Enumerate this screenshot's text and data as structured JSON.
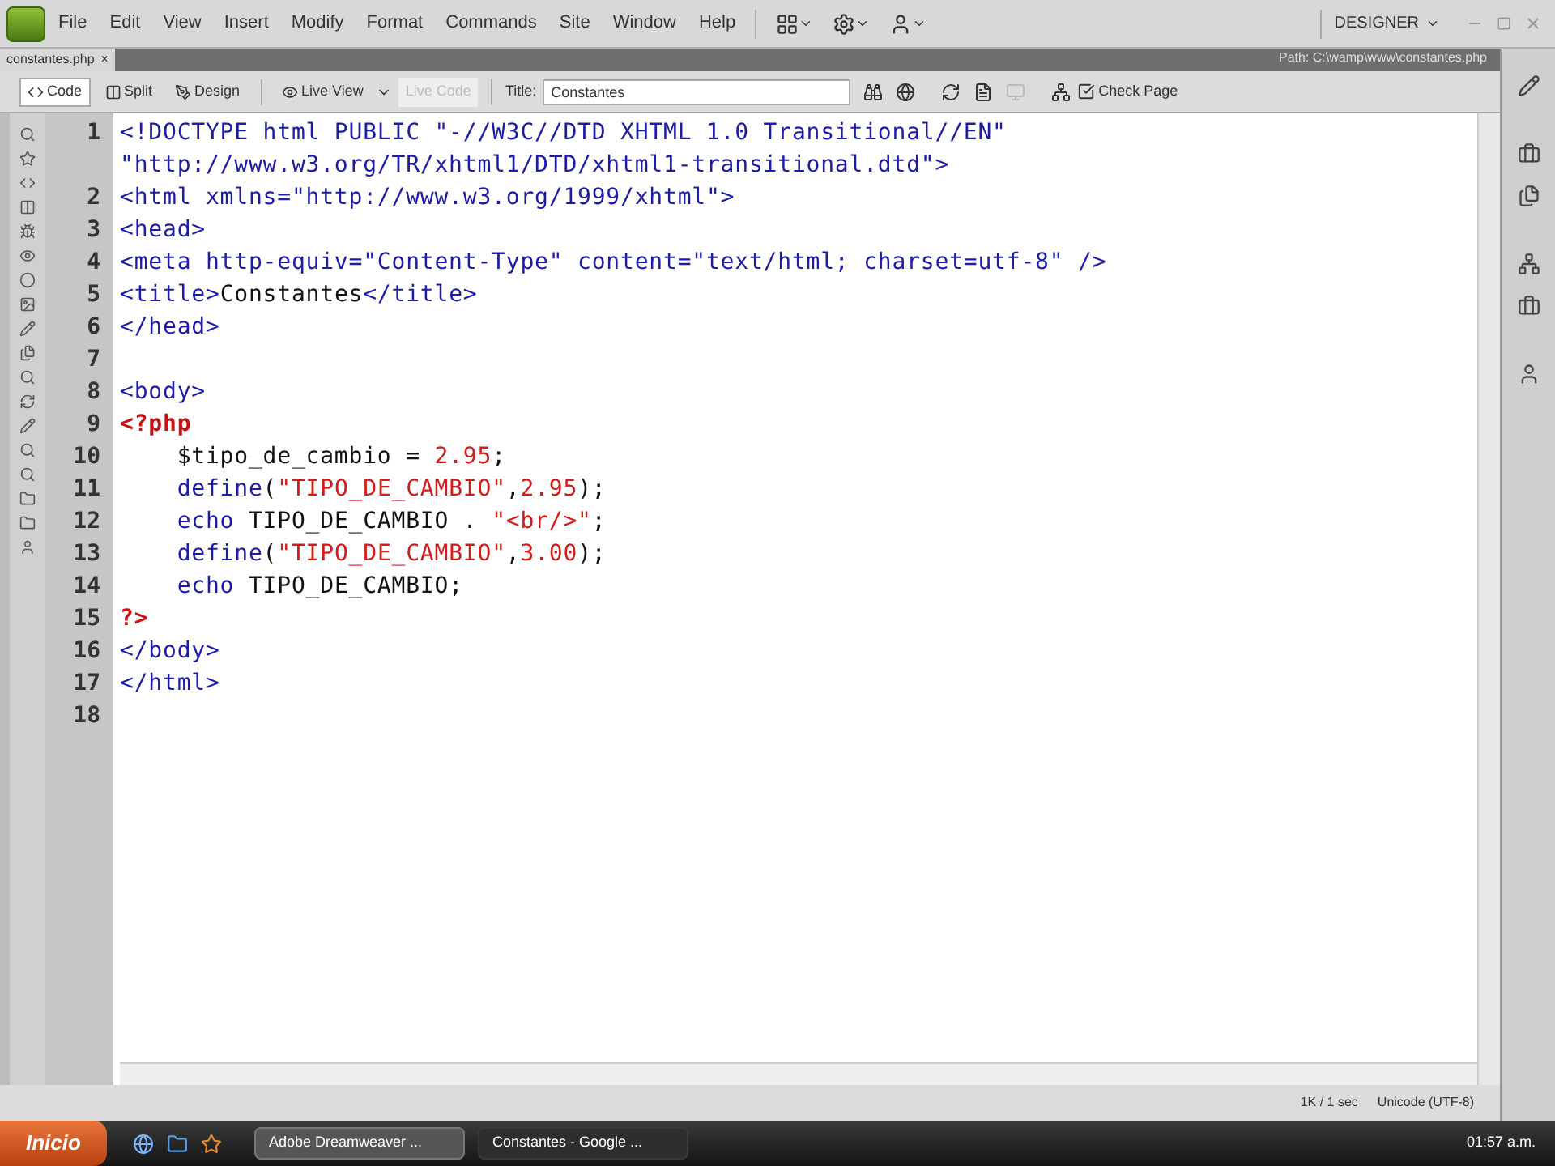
{
  "menu": [
    "File",
    "Edit",
    "View",
    "Insert",
    "Modify",
    "Format",
    "Commands",
    "Site",
    "Window",
    "Help"
  ],
  "workspace": "DESIGNER",
  "document_tab": {
    "label": "constantes.php",
    "close": "×"
  },
  "path": "Path: C:\\wamp\\www\\constantes.php",
  "view_buttons": [
    {
      "label": "Code",
      "selected": true
    },
    {
      "label": "Split",
      "selected": false
    },
    {
      "label": "Design",
      "selected": false
    }
  ],
  "live_view": {
    "label": "Live View"
  },
  "live_code": {
    "label": "Live Code",
    "disabled": true
  },
  "title_field": {
    "label": "Title:",
    "value": "Constantes"
  },
  "check_page": "Check Page",
  "code_lines": [
    {
      "number": "1",
      "rows": [
        [
          {
            "kind": "markup",
            "text": "<!DOCTYPE html PUBLIC \"-//W3C//DTD XHTML 1.0 Transitional//EN\""
          }
        ],
        [
          {
            "kind": "markup",
            "text": "\"http://www.w3.org/TR/xhtml1/DTD/xhtml1-transitional.dtd\">"
          }
        ]
      ]
    },
    {
      "number": "2",
      "rows": [
        [
          {
            "kind": "markup",
            "text": "<html xmlns=\"http://www.w3.org/1999/xhtml\">"
          }
        ]
      ]
    },
    {
      "number": "3",
      "rows": [
        [
          {
            "kind": "markup",
            "text": "<head>"
          }
        ]
      ]
    },
    {
      "number": "4",
      "rows": [
        [
          {
            "kind": "markup",
            "text": "<meta http-equiv=\"Content-Type\" content=\"text/html; charset=utf-8\" />"
          }
        ]
      ]
    },
    {
      "number": "5",
      "rows": [
        [
          {
            "kind": "markup",
            "text": "<title>"
          },
          {
            "kind": "plain",
            "text": "Constantes"
          },
          {
            "kind": "markup",
            "text": "</title>"
          }
        ]
      ]
    },
    {
      "number": "6",
      "rows": [
        [
          {
            "kind": "markup",
            "text": "</head>"
          }
        ]
      ]
    },
    {
      "number": "7",
      "rows": [
        []
      ]
    },
    {
      "number": "8",
      "rows": [
        [
          {
            "kind": "markup",
            "text": "<body>"
          }
        ]
      ]
    },
    {
      "number": "9",
      "rows": [
        [
          {
            "kind": "php",
            "text": "<?php"
          }
        ]
      ]
    },
    {
      "number": "10",
      "rows": [
        [
          {
            "kind": "plain",
            "text": "    $tipo_de_cambio = "
          },
          {
            "kind": "literal",
            "text": "2.95"
          },
          {
            "kind": "plain",
            "text": ";"
          }
        ]
      ]
    },
    {
      "number": "11",
      "rows": [
        [
          {
            "kind": "function",
            "text": "    define"
          },
          {
            "kind": "plain",
            "text": "("
          },
          {
            "kind": "literal",
            "text": "\"TIPO_DE_CAMBIO\""
          },
          {
            "kind": "plain",
            "text": ","
          },
          {
            "kind": "literal",
            "text": "2.95"
          },
          {
            "kind": "plain",
            "text": ");"
          }
        ]
      ]
    },
    {
      "number": "12",
      "rows": [
        [
          {
            "kind": "function",
            "text": "    echo"
          },
          {
            "kind": "plain",
            "text": " TIPO_DE_CAMBIO . "
          },
          {
            "kind": "literal",
            "text": "\"<br/>\""
          },
          {
            "kind": "plain",
            "text": ";"
          }
        ]
      ]
    },
    {
      "number": "13",
      "rows": [
        [
          {
            "kind": "function",
            "text": "    define"
          },
          {
            "kind": "plain",
            "text": "("
          },
          {
            "kind": "literal",
            "text": "\"TIPO_DE_CAMBIO\""
          },
          {
            "kind": "plain",
            "text": ","
          },
          {
            "kind": "literal",
            "text": "3.00"
          },
          {
            "kind": "plain",
            "text": ");"
          }
        ]
      ]
    },
    {
      "number": "14",
      "rows": [
        [
          {
            "kind": "function",
            "text": "    echo"
          },
          {
            "kind": "plain",
            "text": " TIPO_DE_CAMBIO;"
          }
        ]
      ]
    },
    {
      "number": "15",
      "rows": [
        [
          {
            "kind": "php",
            "text": "?>"
          }
        ]
      ]
    },
    {
      "number": "16",
      "rows": [
        [
          {
            "kind": "markup",
            "text": "</body>"
          }
        ]
      ]
    },
    {
      "number": "17",
      "rows": [
        [
          {
            "kind": "markup",
            "text": "</html>"
          }
        ]
      ]
    },
    {
      "number": "18",
      "rows": [
        []
      ]
    }
  ],
  "status_bar": {
    "size": "1K / 1 sec",
    "encoding": "Unicode (UTF-8)"
  },
  "taskbar": {
    "start": "Inicio",
    "tasks": [
      {
        "label": "Adobe Dreamweaver ...",
        "selected": true
      },
      {
        "label": "Constantes - Google ...",
        "selected": false
      }
    ],
    "clock": "01:57 a.m."
  }
}
